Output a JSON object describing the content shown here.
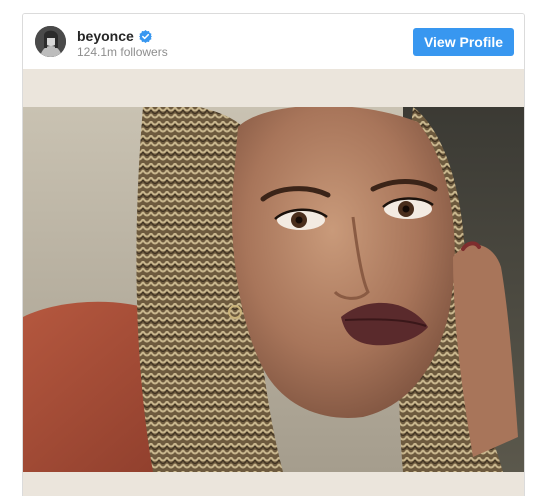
{
  "post": {
    "username": "beyonce",
    "verified": true,
    "followers": "124.1m followers",
    "view_profile_label": "View Profile",
    "avatar_icon": "avatar-photo",
    "verified_icon": "verified-badge-icon",
    "photo_description_icon": "post-photo"
  },
  "colors": {
    "accent": "#3897f0",
    "username": "#262626",
    "secondary_text": "#8e8e8e",
    "photo_border": "#ebe5dc"
  }
}
